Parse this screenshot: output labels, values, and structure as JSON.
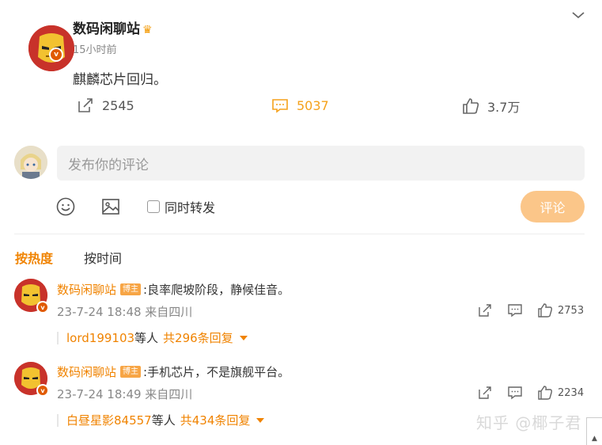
{
  "post": {
    "author": "数码闲聊站",
    "time": "15小时前",
    "content": "麒麟芯片回归。",
    "reposts": "2545",
    "comments": "5037",
    "likes": "3.7万"
  },
  "composer": {
    "placeholder": "发布你的评论",
    "also_repost": "同时转发",
    "submit": "评论"
  },
  "sort": {
    "hot": "按热度",
    "time": "按时间"
  },
  "comments": [
    {
      "name": "数码闲聊站",
      "tag": "博主",
      "text": ":良率爬坡阶段，静候佳音。",
      "meta": "23-7-24 18:48 来自四川",
      "likes": "2753",
      "reply_user": "lord199103",
      "reply_mid": " 等人",
      "reply_count": "共296条回复"
    },
    {
      "name": "数码闲聊站",
      "tag": "博主",
      "text": ":手机芯片，不是旗舰平台。",
      "meta": "23-7-24 18:49 来自四川",
      "likes": "2234",
      "reply_user": "白昼星影84557",
      "reply_mid": " 等人",
      "reply_count": "共434条回复"
    }
  ],
  "watermark": "知乎 @椰子君",
  "colors": {
    "accent": "#f08300",
    "submit_bg": "#fbc689",
    "comment_icon": "#f5a11b"
  }
}
